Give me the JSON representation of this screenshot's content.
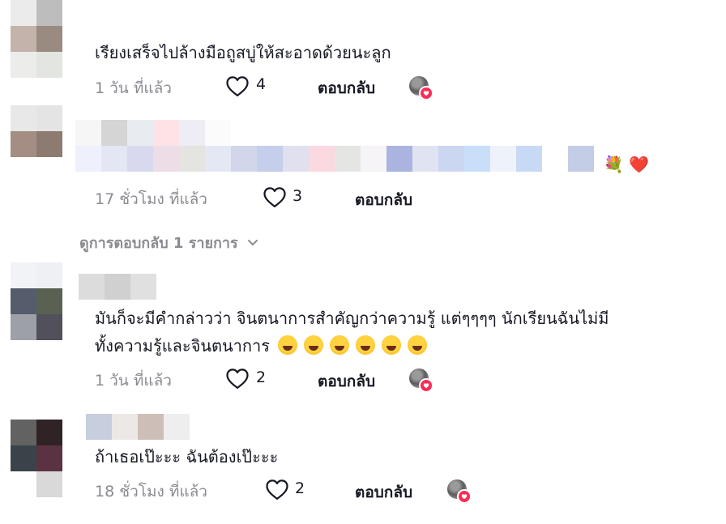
{
  "comments": [
    {
      "text": "เรียงเสร็จไปล้างมือถูสบู่ให้สะอาดด้วยนะลูก",
      "time": "1 วัน ที่แล้ว",
      "likes": "4",
      "reply": "ตอบกลับ"
    },
    {
      "text": "",
      "time": "17 ชั่วโมง ที่แล้ว",
      "likes": "3",
      "reply": "ตอบกลับ",
      "tail_emoji": "💐 ❤️"
    },
    {
      "text_line1": "มันก็จะมีคำกล่าวว่า จินตนาการสำคัญกว่าความรู้ แต่ๆๆๆๆ นักเรียนฉันไม่มี",
      "text_line2": "ทั้งความรู้และจินตนาการ",
      "time": "1 วัน ที่แล้ว",
      "likes": "2",
      "reply": "ตอบกลับ"
    },
    {
      "text": "ถ้าเธอเป๊ะะะ ฉันต้องเป๊ะะะ",
      "time": "18 ชั่วโมง ที่แล้ว",
      "likes": "2",
      "reply": "ตอบกลับ"
    }
  ],
  "view_replies": "ดูการตอบกลับ 1 รายการ",
  "colors": {
    "heart_red": "#fe2c55",
    "muted": "#8a8b91",
    "text": "#161823"
  },
  "icons": [
    "heart-outline-icon",
    "chevron-down-icon",
    "rolling-laughing-emoji",
    "bouquet-emoji",
    "red-heart-emoji"
  ]
}
